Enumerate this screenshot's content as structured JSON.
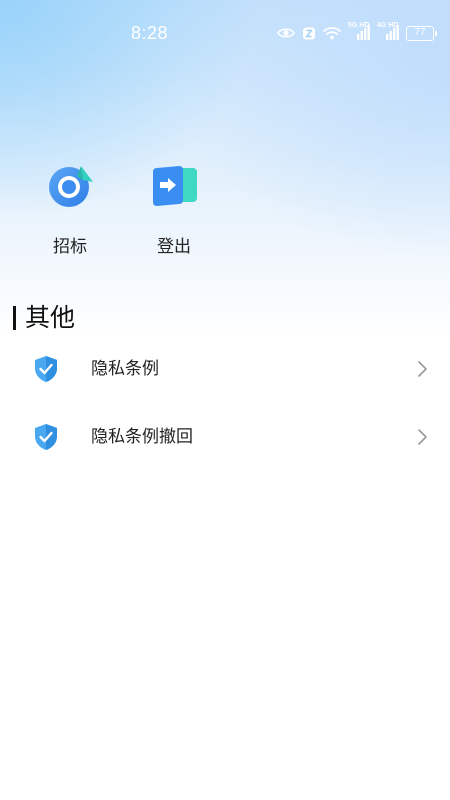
{
  "status_bar": {
    "time": "8:28",
    "network_label_1": "5G HD",
    "network_label_2": "4G HD",
    "battery": "77"
  },
  "quick_actions": [
    {
      "label": "招标",
      "icon": "compass-target-icon"
    },
    {
      "label": "登出",
      "icon": "logout-door-icon"
    }
  ],
  "section": {
    "title": "其他"
  },
  "menu": [
    {
      "label": "隐私条例",
      "icon": "shield-check-icon"
    },
    {
      "label": "隐私条例撤回",
      "icon": "shield-check-icon"
    }
  ],
  "colors": {
    "accent_blue": "#3B8BF0",
    "accent_teal": "#36D6C4",
    "shield_blue": "#4AA8F0"
  }
}
